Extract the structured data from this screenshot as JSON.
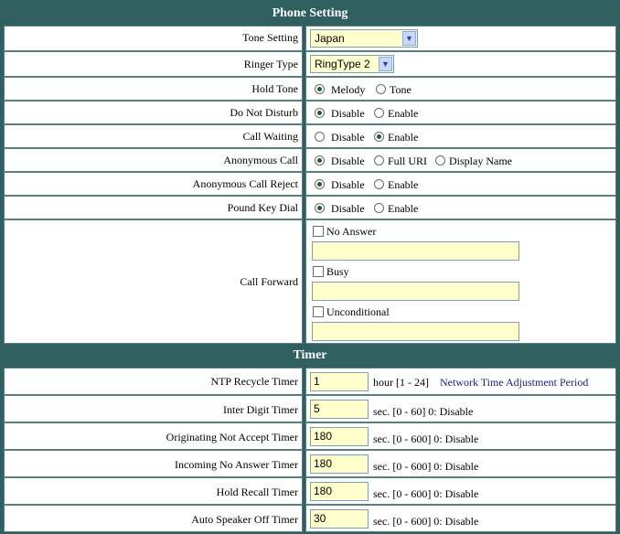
{
  "phone_setting": {
    "title": "Phone Setting",
    "tone_setting": {
      "label": "Tone Setting",
      "value": "Japan"
    },
    "ringer_type": {
      "label": "Ringer Type",
      "value": "RingType 2"
    },
    "hold_tone": {
      "label": "Hold Tone",
      "options": [
        "Melody",
        "Tone"
      ],
      "selected": "Melody"
    },
    "do_not_disturb": {
      "label": "Do Not Disturb",
      "options": [
        "Disable",
        "Enable"
      ],
      "selected": "Disable"
    },
    "call_waiting": {
      "label": "Call Waiting",
      "options": [
        "Disable",
        "Enable"
      ],
      "selected": "Enable"
    },
    "anonymous_call": {
      "label": "Anonymous Call",
      "options": [
        "Disable",
        "Full URI",
        "Display Name"
      ],
      "selected": "Disable"
    },
    "anonymous_call_reject": {
      "label": "Anonymous Call Reject",
      "options": [
        "Disable",
        "Enable"
      ],
      "selected": "Disable"
    },
    "pound_key_dial": {
      "label": "Pound Key Dial",
      "options": [
        "Disable",
        "Enable"
      ],
      "selected": "Disable"
    },
    "call_forward": {
      "label": "Call Forward",
      "no_answer": {
        "label": "No Answer",
        "checked": false,
        "value": ""
      },
      "busy": {
        "label": "Busy",
        "checked": false,
        "value": ""
      },
      "unconditional": {
        "label": "Unconditional",
        "checked": false,
        "value": ""
      }
    }
  },
  "timer": {
    "title": "Timer",
    "ntp_recycle": {
      "label": "NTP Recycle Timer",
      "value": "1",
      "unit": "hour [1 - 24]",
      "note": "Network Time Adjustment Period"
    },
    "inter_digit": {
      "label": "Inter Digit Timer",
      "value": "5",
      "unit": "sec. [0 - 60] 0: Disable"
    },
    "originating_not_accept": {
      "label": "Originating Not Accept Timer",
      "value": "180",
      "unit": "sec. [0 - 600] 0: Disable"
    },
    "incoming_no_answer": {
      "label": "Incoming No Answer Timer",
      "value": "180",
      "unit": "sec. [0 - 600] 0: Disable"
    },
    "hold_recall": {
      "label": "Hold Recall Timer",
      "value": "180",
      "unit": "sec. [0 - 600] 0: Disable"
    },
    "auto_speaker_off": {
      "label": "Auto Speaker Off Timer",
      "value": "30",
      "unit": "sec. [0 - 600] 0: Disable"
    }
  }
}
